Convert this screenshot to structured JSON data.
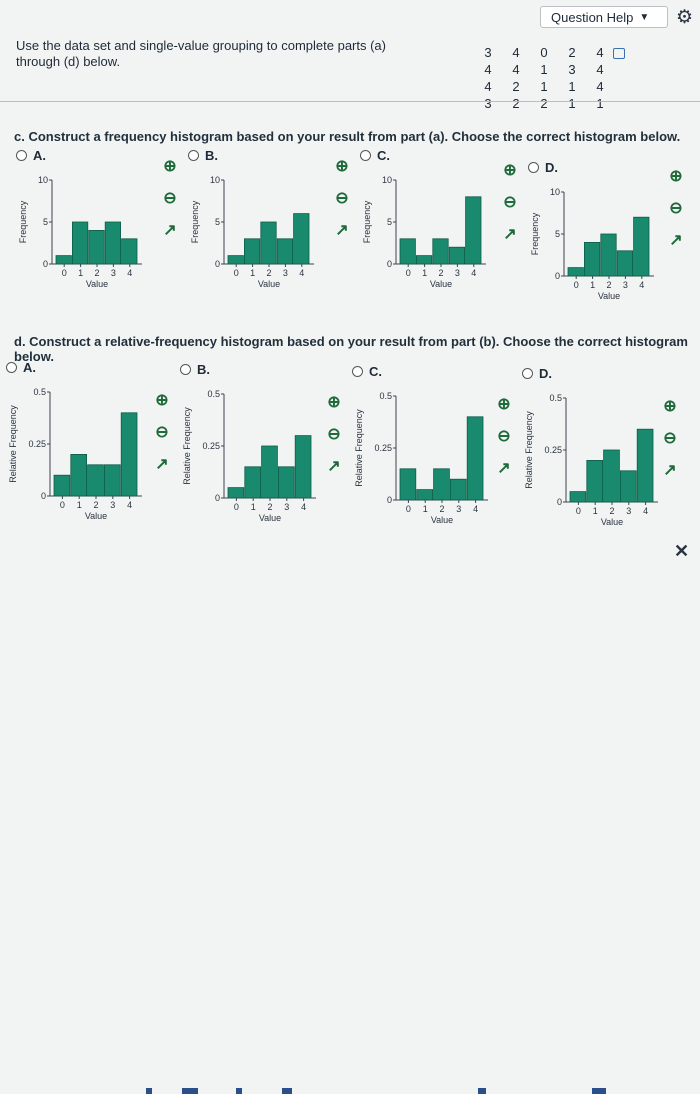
{
  "header": {
    "help_label": "Question Help",
    "help_icon": "caret-down-icon",
    "settings_icon": "gear-icon"
  },
  "instructions": "Use the data set and single-value grouping to complete parts (a) through (d) below.",
  "dataset": {
    "rows": [
      [
        "3",
        "4",
        "0",
        "2",
        "4"
      ],
      [
        "4",
        "4",
        "1",
        "3",
        "4"
      ],
      [
        "4",
        "2",
        "1",
        "1",
        "4"
      ],
      [
        "3",
        "2",
        "2",
        "1",
        "1"
      ]
    ]
  },
  "part_c": {
    "question": "c. Construct a frequency histogram based on your result from part (a). Choose the correct histogram below.",
    "options": [
      {
        "letter": "A.",
        "ylabel": "Frequency",
        "xlabel": "Value",
        "yticks": [
          "0",
          "5",
          "10"
        ],
        "xticks": [
          "0",
          "1",
          "2",
          "3",
          "4"
        ]
      },
      {
        "letter": "B.",
        "ylabel": "Frequency",
        "xlabel": "Value",
        "yticks": [
          "0",
          "5",
          "10"
        ],
        "xticks": [
          "0",
          "1",
          "2",
          "3",
          "4"
        ]
      },
      {
        "letter": "C.",
        "ylabel": "Frequency",
        "xlabel": "Value",
        "yticks": [
          "0",
          "5",
          "10"
        ],
        "xticks": [
          "0",
          "1",
          "2",
          "3",
          "4"
        ]
      },
      {
        "letter": "D.",
        "ylabel": "Frequency",
        "xlabel": "Value",
        "yticks": [
          "0",
          "5",
          "10"
        ],
        "xticks": [
          "0",
          "1",
          "2",
          "3",
          "4"
        ]
      }
    ]
  },
  "part_d": {
    "question": "d. Construct a relative-frequency histogram based on your result from part (b). Choose the correct histogram below.",
    "options": [
      {
        "letter": "A.",
        "ylabel": "Relative Frequency",
        "xlabel": "Value",
        "yticks": [
          "0",
          "0.25",
          "0.5"
        ],
        "xticks": [
          "0",
          "1",
          "2",
          "3",
          "4"
        ]
      },
      {
        "letter": "B.",
        "ylabel": "Relative Frequency",
        "xlabel": "Value",
        "yticks": [
          "0",
          "0.25",
          "0.5"
        ],
        "xticks": [
          "0",
          "1",
          "2",
          "3",
          "4"
        ]
      },
      {
        "letter": "C.",
        "ylabel": "Relative Frequency",
        "xlabel": "Value",
        "yticks": [
          "0",
          "0.25",
          "0.5"
        ],
        "xticks": [
          "0",
          "1",
          "2",
          "3",
          "4"
        ]
      },
      {
        "letter": "D.",
        "ylabel": "Relative Frequency",
        "xlabel": "Value",
        "yticks": [
          "0",
          "0.25",
          "0.5"
        ],
        "xticks": [
          "0",
          "1",
          "2",
          "3",
          "4"
        ]
      }
    ]
  },
  "tool_icons": [
    "zoom-in-icon",
    "zoom-out-icon",
    "open-new-window-icon"
  ],
  "colors": {
    "bar": "#1a8a6e",
    "bar_edge": "#0e5c48",
    "accent": "#3a6fb0"
  },
  "chart_data": [
    {
      "type": "bar",
      "categories": [
        "0",
        "1",
        "2",
        "3",
        "4"
      ],
      "values": [
        1,
        5,
        4,
        5,
        3
      ],
      "xlabel": "Value",
      "ylabel": "Frequency",
      "ylim": [
        0,
        10
      ]
    },
    {
      "type": "bar",
      "categories": [
        "0",
        "1",
        "2",
        "3",
        "4"
      ],
      "values": [
        1,
        3,
        5,
        3,
        6
      ],
      "xlabel": "Value",
      "ylabel": "Frequency",
      "ylim": [
        0,
        10
      ]
    },
    {
      "type": "bar",
      "categories": [
        "0",
        "1",
        "2",
        "3",
        "4"
      ],
      "values": [
        3,
        1,
        3,
        2,
        8
      ],
      "xlabel": "Value",
      "ylabel": "Frequency",
      "ylim": [
        0,
        10
      ]
    },
    {
      "type": "bar",
      "categories": [
        "0",
        "1",
        "2",
        "3",
        "4"
      ],
      "values": [
        1,
        4,
        5,
        3,
        7
      ],
      "xlabel": "Value",
      "ylabel": "Frequency",
      "ylim": [
        0,
        10
      ]
    },
    {
      "type": "bar",
      "categories": [
        "0",
        "1",
        "2",
        "3",
        "4"
      ],
      "values": [
        0.1,
        0.2,
        0.15,
        0.15,
        0.4
      ],
      "xlabel": "Value",
      "ylabel": "Relative Frequency",
      "ylim": [
        0,
        0.5
      ]
    },
    {
      "type": "bar",
      "categories": [
        "0",
        "1",
        "2",
        "3",
        "4"
      ],
      "values": [
        0.05,
        0.15,
        0.25,
        0.15,
        0.3
      ],
      "xlabel": "Value",
      "ylabel": "Relative Frequency",
      "ylim": [
        0,
        0.5
      ]
    },
    {
      "type": "bar",
      "categories": [
        "0",
        "1",
        "2",
        "3",
        "4"
      ],
      "values": [
        0.15,
        0.05,
        0.15,
        0.1,
        0.4
      ],
      "xlabel": "Value",
      "ylabel": "Relative Frequency",
      "ylim": [
        0,
        0.5
      ]
    },
    {
      "type": "bar",
      "categories": [
        "0",
        "1",
        "2",
        "3",
        "4"
      ],
      "values": [
        0.05,
        0.2,
        0.25,
        0.15,
        0.35
      ],
      "xlabel": "Value",
      "ylabel": "Relative Frequency",
      "ylim": [
        0,
        0.5
      ]
    }
  ]
}
